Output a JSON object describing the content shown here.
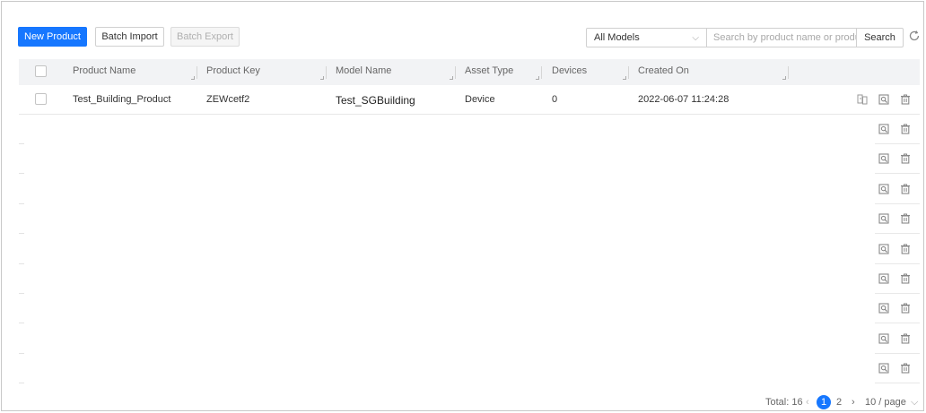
{
  "toolbar": {
    "new_product": "New Product",
    "batch_import": "Batch Import",
    "batch_export": "Batch Export",
    "model_filter": "All Models",
    "search_placeholder": "Search by product name or produ...",
    "search_button": "Search"
  },
  "table": {
    "columns": [
      "Product Name",
      "Product Key",
      "Model Name",
      "Asset Type",
      "Devices",
      "Created On"
    ],
    "rows": [
      {
        "product_name": "Test_Building_Product",
        "product_key": "ZEWcetf2",
        "model_name": "Test_SGBuilding",
        "asset_type": "Device",
        "devices": "0",
        "created_on": "2022-06-07 11:24:28"
      }
    ],
    "icons": [
      "copy-icon",
      "view-detail-icon",
      "delete-icon"
    ]
  },
  "pagination": {
    "total": "Total: 16",
    "pages": [
      "1",
      "2"
    ],
    "current": "1",
    "page_size": "10 / page"
  },
  "colors": {
    "primary": "#1677ff",
    "header_bg": "#f2f3f5",
    "border": "#d0d0d0"
  }
}
